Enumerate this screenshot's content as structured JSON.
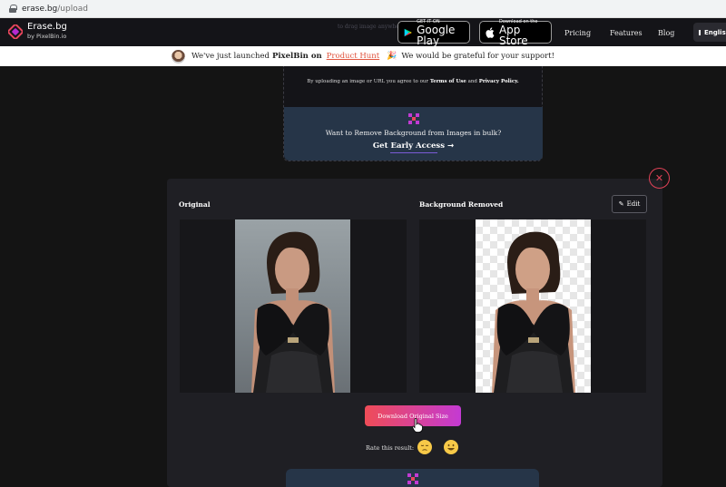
{
  "browser": {
    "url_host": "erase.bg",
    "url_path": "/upload"
  },
  "navbar": {
    "brand_name": "Erase.bg",
    "brand_sub": "by PixelBin.io",
    "google_play_small": "GET IT ON",
    "google_play_big": "Google Play",
    "app_store_small": "Download on the",
    "app_store_big": "App Store",
    "links": [
      "Pricing",
      "Features",
      "Blog"
    ],
    "language": "English"
  },
  "announcement": {
    "prefix": "We've just launched",
    "brand": "PixelBin on",
    "link": "Product Hunt",
    "suffix": "We would be grateful for your support!"
  },
  "upload": {
    "terms_prefix": "By uploading an image or URL you agree to our",
    "terms_link": "Terms of Use",
    "and": "and",
    "privacy_link": "Privacy Policy.",
    "bulk_question": "Want to Remove Background from Images in bulk?",
    "bulk_cta": "Get Early Access",
    "bulk_cta_arrow": "→"
  },
  "result": {
    "original_label": "Original",
    "removed_label": "Background Removed",
    "edit_label": "Edit",
    "download_label": "Download Original Size",
    "rate_label": "Rate this result:",
    "close_symbol": "✕"
  },
  "colors": {
    "accent_start": "#ef4c57",
    "accent_end": "#c43ad3",
    "close_red": "#e04257",
    "panel_blue": "#263548"
  }
}
